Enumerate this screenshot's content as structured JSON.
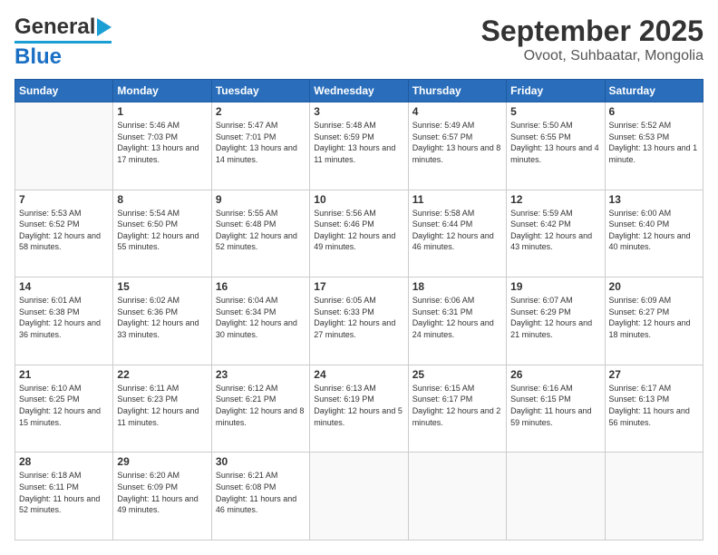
{
  "logo": {
    "line1": "General",
    "line2": "Blue"
  },
  "header": {
    "month_year": "September 2025",
    "location": "Ovoot, Suhbaatar, Mongolia"
  },
  "days_of_week": [
    "Sunday",
    "Monday",
    "Tuesday",
    "Wednesday",
    "Thursday",
    "Friday",
    "Saturday"
  ],
  "weeks": [
    [
      {
        "day": "",
        "empty": true
      },
      {
        "day": "1",
        "sunrise": "5:46 AM",
        "sunset": "7:03 PM",
        "daylight": "13 hours and 17 minutes."
      },
      {
        "day": "2",
        "sunrise": "5:47 AM",
        "sunset": "7:01 PM",
        "daylight": "13 hours and 14 minutes."
      },
      {
        "day": "3",
        "sunrise": "5:48 AM",
        "sunset": "6:59 PM",
        "daylight": "13 hours and 11 minutes."
      },
      {
        "day": "4",
        "sunrise": "5:49 AM",
        "sunset": "6:57 PM",
        "daylight": "13 hours and 8 minutes."
      },
      {
        "day": "5",
        "sunrise": "5:50 AM",
        "sunset": "6:55 PM",
        "daylight": "13 hours and 4 minutes."
      },
      {
        "day": "6",
        "sunrise": "5:52 AM",
        "sunset": "6:53 PM",
        "daylight": "13 hours and 1 minute."
      }
    ],
    [
      {
        "day": "7",
        "sunrise": "5:53 AM",
        "sunset": "6:52 PM",
        "daylight": "12 hours and 58 minutes."
      },
      {
        "day": "8",
        "sunrise": "5:54 AM",
        "sunset": "6:50 PM",
        "daylight": "12 hours and 55 minutes."
      },
      {
        "day": "9",
        "sunrise": "5:55 AM",
        "sunset": "6:48 PM",
        "daylight": "12 hours and 52 minutes."
      },
      {
        "day": "10",
        "sunrise": "5:56 AM",
        "sunset": "6:46 PM",
        "daylight": "12 hours and 49 minutes."
      },
      {
        "day": "11",
        "sunrise": "5:58 AM",
        "sunset": "6:44 PM",
        "daylight": "12 hours and 46 minutes."
      },
      {
        "day": "12",
        "sunrise": "5:59 AM",
        "sunset": "6:42 PM",
        "daylight": "12 hours and 43 minutes."
      },
      {
        "day": "13",
        "sunrise": "6:00 AM",
        "sunset": "6:40 PM",
        "daylight": "12 hours and 40 minutes."
      }
    ],
    [
      {
        "day": "14",
        "sunrise": "6:01 AM",
        "sunset": "6:38 PM",
        "daylight": "12 hours and 36 minutes."
      },
      {
        "day": "15",
        "sunrise": "6:02 AM",
        "sunset": "6:36 PM",
        "daylight": "12 hours and 33 minutes."
      },
      {
        "day": "16",
        "sunrise": "6:04 AM",
        "sunset": "6:34 PM",
        "daylight": "12 hours and 30 minutes."
      },
      {
        "day": "17",
        "sunrise": "6:05 AM",
        "sunset": "6:33 PM",
        "daylight": "12 hours and 27 minutes."
      },
      {
        "day": "18",
        "sunrise": "6:06 AM",
        "sunset": "6:31 PM",
        "daylight": "12 hours and 24 minutes."
      },
      {
        "day": "19",
        "sunrise": "6:07 AM",
        "sunset": "6:29 PM",
        "daylight": "12 hours and 21 minutes."
      },
      {
        "day": "20",
        "sunrise": "6:09 AM",
        "sunset": "6:27 PM",
        "daylight": "12 hours and 18 minutes."
      }
    ],
    [
      {
        "day": "21",
        "sunrise": "6:10 AM",
        "sunset": "6:25 PM",
        "daylight": "12 hours and 15 minutes."
      },
      {
        "day": "22",
        "sunrise": "6:11 AM",
        "sunset": "6:23 PM",
        "daylight": "12 hours and 11 minutes."
      },
      {
        "day": "23",
        "sunrise": "6:12 AM",
        "sunset": "6:21 PM",
        "daylight": "12 hours and 8 minutes."
      },
      {
        "day": "24",
        "sunrise": "6:13 AM",
        "sunset": "6:19 PM",
        "daylight": "12 hours and 5 minutes."
      },
      {
        "day": "25",
        "sunrise": "6:15 AM",
        "sunset": "6:17 PM",
        "daylight": "12 hours and 2 minutes."
      },
      {
        "day": "26",
        "sunrise": "6:16 AM",
        "sunset": "6:15 PM",
        "daylight": "11 hours and 59 minutes."
      },
      {
        "day": "27",
        "sunrise": "6:17 AM",
        "sunset": "6:13 PM",
        "daylight": "11 hours and 56 minutes."
      }
    ],
    [
      {
        "day": "28",
        "sunrise": "6:18 AM",
        "sunset": "6:11 PM",
        "daylight": "11 hours and 52 minutes."
      },
      {
        "day": "29",
        "sunrise": "6:20 AM",
        "sunset": "6:09 PM",
        "daylight": "11 hours and 49 minutes."
      },
      {
        "day": "30",
        "sunrise": "6:21 AM",
        "sunset": "6:08 PM",
        "daylight": "11 hours and 46 minutes."
      },
      {
        "day": "",
        "empty": true
      },
      {
        "day": "",
        "empty": true
      },
      {
        "day": "",
        "empty": true
      },
      {
        "day": "",
        "empty": true
      }
    ]
  ],
  "labels": {
    "sunrise": "Sunrise:",
    "sunset": "Sunset:",
    "daylight": "Daylight:"
  }
}
